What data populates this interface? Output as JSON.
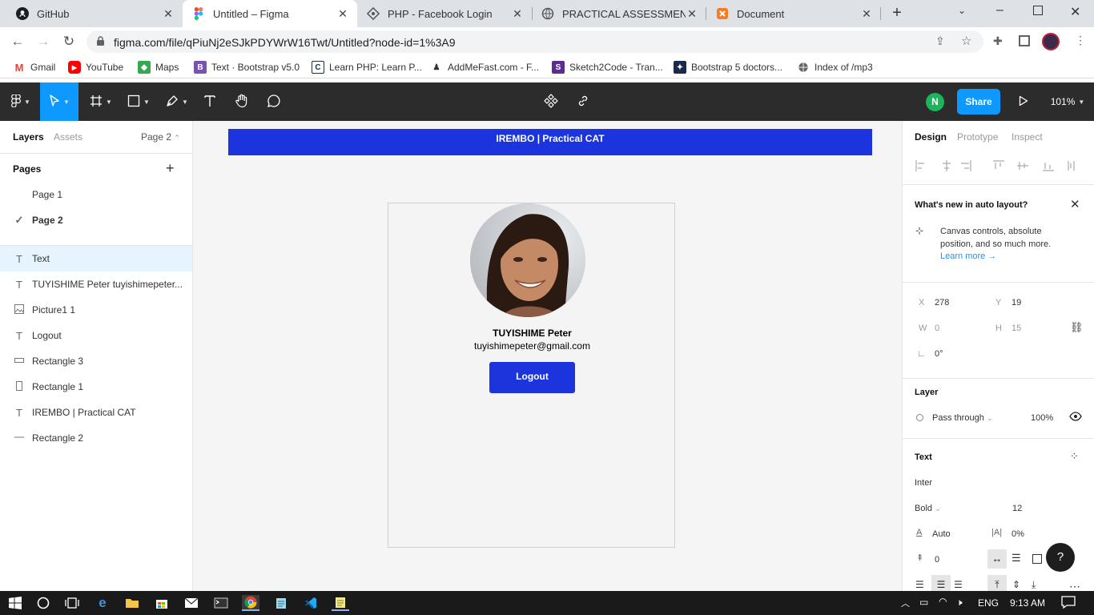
{
  "browser": {
    "tabs": [
      {
        "label": "GitHub",
        "icon": "github-icon"
      },
      {
        "label": "Untitled – Figma",
        "icon": "figma-icon"
      },
      {
        "label": "PHP - Facebook Login",
        "icon": "php-icon"
      },
      {
        "label": "PRACTICAL ASSESSMENT.pdf",
        "icon": "globe-icon"
      },
      {
        "label": "Document",
        "icon": "xampp-icon"
      }
    ],
    "url": "figma.com/file/qPiuNj2eSJkPDYWrW16Twt/Untitled?node-id=1%3A9",
    "bookmarks": [
      {
        "label": "Gmail",
        "icon": "gmail-icon"
      },
      {
        "label": "YouTube",
        "icon": "youtube-icon"
      },
      {
        "label": "Maps",
        "icon": "maps-icon"
      },
      {
        "label": "Text · Bootstrap v5.0",
        "icon": "bootstrap-icon"
      },
      {
        "label": "Learn PHP: Learn P...",
        "icon": "codecademy-icon"
      },
      {
        "label": "AddMeFast.com - F...",
        "icon": "addmefast-icon"
      },
      {
        "label": "Sketch2Code - Tran...",
        "icon": "sketch2code-icon"
      },
      {
        "label": "Bootstrap 5 doctors...",
        "icon": "template-icon"
      },
      {
        "label": "Index of /mp3",
        "icon": "globe-icon"
      }
    ]
  },
  "toolbar": {
    "avatar_initial": "N",
    "share_label": "Share",
    "zoom": "101%"
  },
  "left_panel": {
    "tab_layers": "Layers",
    "tab_assets": "Assets",
    "current_page": "Page 2",
    "pages_title": "Pages",
    "pages": [
      "Page 1",
      "Page 2"
    ],
    "layers": [
      {
        "label": "Text",
        "icon": "text-icon"
      },
      {
        "label": "TUYISHIME Peter tuyishimepeter...",
        "icon": "text-icon"
      },
      {
        "label": "Picture1 1",
        "icon": "image-icon"
      },
      {
        "label": "Logout",
        "icon": "text-icon"
      },
      {
        "label": "Rectangle 3",
        "icon": "rectangle-icon"
      },
      {
        "label": "Rectangle 1",
        "icon": "rectangle-icon"
      },
      {
        "label": "IREMBO | Practical CAT",
        "icon": "text-icon"
      },
      {
        "label": "Rectangle 2",
        "icon": "line-icon"
      }
    ]
  },
  "canvas": {
    "banner_title": "IREMBO | Practical CAT",
    "user_name": "TUYISHIME Peter",
    "user_email": "tuyishimepeter@gmail.com",
    "logout_label": "Logout"
  },
  "right_panel": {
    "tab_design": "Design",
    "tab_prototype": "Prototype",
    "tab_inspect": "Inspect",
    "whats_new_title": "What's new in auto layout?",
    "whats_new_body": "Canvas controls, absolute position, and so much more.",
    "learn_more": "Learn more →",
    "x_label": "X",
    "x_value": "278",
    "y_label": "Y",
    "y_value": "19",
    "w_label": "W",
    "w_value": "0",
    "h_label": "H",
    "h_value": "15",
    "rotation": "0°",
    "layer_title": "Layer",
    "blend_mode": "Pass through",
    "opacity": "100%",
    "text_title": "Text",
    "font_family": "Inter",
    "font_weight": "Bold",
    "font_size": "12",
    "line_height": "Auto",
    "letter_spacing": "0%",
    "paragraph_spacing": "0",
    "help": "?"
  },
  "taskbar": {
    "language": "ENG",
    "time": "9:13 AM"
  }
}
